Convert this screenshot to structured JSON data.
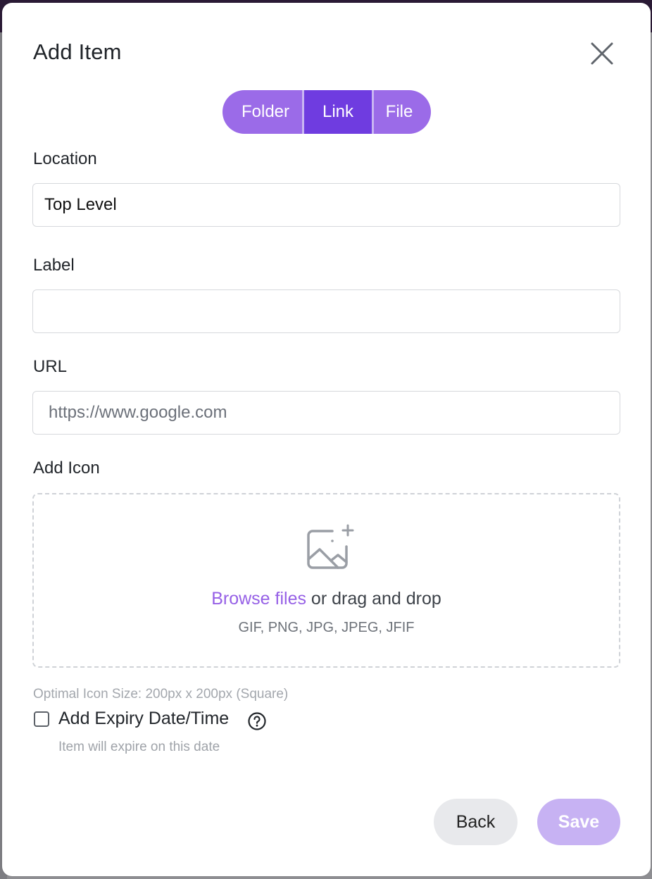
{
  "dialog": {
    "title": "Add Item"
  },
  "type_tabs": {
    "items": [
      {
        "label": "Folder",
        "selected": false
      },
      {
        "label": "Link",
        "selected": true
      },
      {
        "label": "File",
        "selected": false
      }
    ]
  },
  "form": {
    "location": {
      "label": "Location",
      "value": "Top Level"
    },
    "label_field": {
      "label": "Label",
      "value": ""
    },
    "url": {
      "label": "URL",
      "placeholder": "https://www.google.com"
    },
    "icon": {
      "label": "Add Icon",
      "browse_link": "Browse files",
      "drag_text": "or drag and drop",
      "formats": "GIF, PNG, JPG, JPEG, JFIF",
      "size_hint": "Optimal Icon Size: 200px x 200px (Square)"
    },
    "expiry": {
      "label": "Add Expiry Date/Time",
      "checked": false,
      "hint": "Item will expire on this date"
    }
  },
  "actions": {
    "back_label": "Back",
    "save_label": "Save"
  },
  "colors": {
    "accent": "#6f3ce0",
    "accent_light": "#9b6be8",
    "link": "#9660e6",
    "save_disabled": "#c7b2f3"
  },
  "icons": [
    "close-icon",
    "image-plus-icon",
    "help-circle-icon"
  ]
}
